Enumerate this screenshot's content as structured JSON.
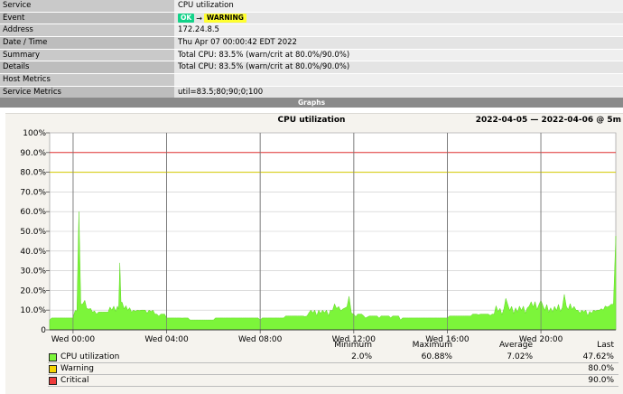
{
  "info_table": [
    {
      "key": "Service",
      "value": "CPU utilization"
    },
    {
      "key": "Event",
      "state_from": "OK",
      "state_to": "WARNING",
      "arrow": "→"
    },
    {
      "key": "Address",
      "value": "172.24.8.5"
    },
    {
      "key": "Date / Time",
      "value": "Thu Apr 07 00:00:42 EDT 2022"
    },
    {
      "key": "Summary",
      "value": "Total CPU: 83.5% (warn/crit at 80.0%/90.0%)"
    },
    {
      "key": "Details",
      "value": "Total CPU: 83.5% (warn/crit at 80.0%/90.0%)"
    },
    {
      "key": "Host Metrics",
      "value": ""
    },
    {
      "key": "Service Metrics",
      "value": "util=83.5;80;90;0;100"
    }
  ],
  "graphs_header": "Graphs",
  "graph": {
    "title": "CPU utilization",
    "range": "2022-04-05 — 2022-04-06 @ 5m"
  },
  "colors": {
    "area": "#7cf53a",
    "warn_line": "#d6cc00",
    "crit_line": "#e03030",
    "warn_swatch": "#f5d400",
    "crit_swatch": "#ee3b3b"
  },
  "legend": {
    "headers": {
      "min": "Minimum",
      "max": "Maximum",
      "avg": "Average",
      "last": "Last"
    },
    "rows": [
      {
        "name": "CPU utilization",
        "min": "2.0%",
        "max": "60.88%",
        "avg": "7.02%",
        "last": "47.62%",
        "color": "#7cf53a"
      },
      {
        "name": "Warning",
        "min": "",
        "max": "",
        "avg": "",
        "last": "80.0%",
        "color": "#f5d400"
      },
      {
        "name": "Critical",
        "min": "",
        "max": "",
        "avg": "",
        "last": "90.0%",
        "color": "#ee3b3b"
      }
    ]
  },
  "chart_data": {
    "type": "area",
    "title": "CPU utilization",
    "subtitle": "2022-04-05 — 2022-04-06 @ 5m",
    "x_tick_labels": [
      "Wed 00:00",
      "Wed 04:00",
      "Wed 08:00",
      "Wed 12:00",
      "Wed 16:00",
      "Wed 20:00"
    ],
    "y_tick_labels": [
      "0",
      "10.0%",
      "20.0%",
      "30.0%",
      "40.0%",
      "50.0%",
      "60.0%",
      "70.0%",
      "80.0%",
      "90.0%",
      "100%"
    ],
    "ylim": [
      0,
      100
    ],
    "x_hours": [
      -1.0,
      0.0,
      0.25,
      0.5,
      1.0,
      1.5,
      1.9,
      2.0,
      2.1,
      2.5,
      3.0,
      3.5,
      4.0,
      5.0,
      6.0,
      7.0,
      8.0,
      9.0,
      10.0,
      11.0,
      11.8,
      12.0,
      12.5,
      13.0,
      14.0,
      15.0,
      16.0,
      17.0,
      18.0,
      18.5,
      19.0,
      19.5,
      20.0,
      20.5,
      21.0,
      21.5,
      22.0,
      22.5,
      23.0,
      23.2
    ],
    "series": [
      {
        "name": "CPU utilization",
        "values": [
          5,
          6,
          60,
          15,
          8,
          9,
          12,
          34,
          14,
          9,
          10,
          8,
          6,
          5,
          5,
          6,
          5,
          6,
          7,
          10,
          17,
          8,
          6,
          7,
          5,
          6,
          6,
          7,
          8,
          16,
          9,
          12,
          15,
          9,
          18,
          10,
          7,
          10,
          13,
          47.62
        ]
      }
    ],
    "thresholds": [
      {
        "name": "Warning",
        "value": 80
      },
      {
        "name": "Critical",
        "value": 90
      }
    ],
    "grid": true
  }
}
